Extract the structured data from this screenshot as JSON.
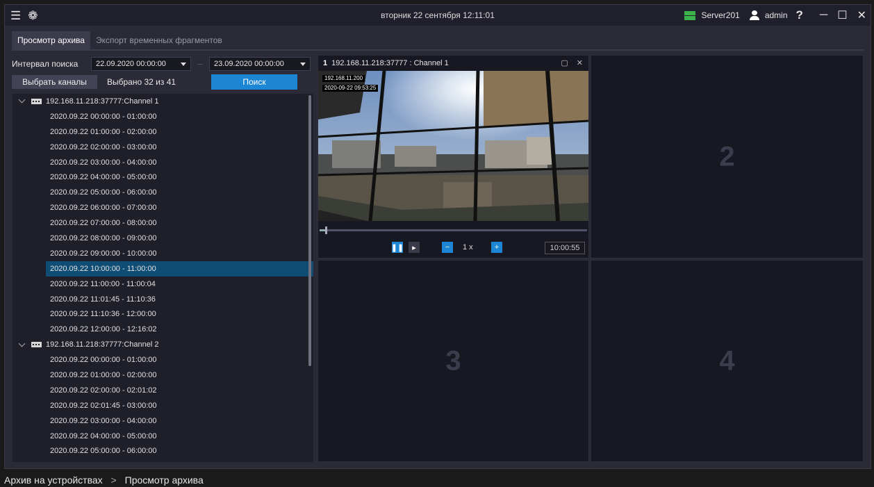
{
  "titlebar": {
    "datetime": "вторник 22 сентября 12:11:01",
    "server": "Server201",
    "user": "admin",
    "help_glyph": "?",
    "icons": [
      "menu-icon",
      "gear-icon",
      "server-icon",
      "user-icon",
      "minimize-icon",
      "maximize-icon",
      "close-icon"
    ]
  },
  "tabs": [
    "Просмотр архива",
    "Экспорт временных фрагментов"
  ],
  "search": {
    "interval_label": "Интервал поиска",
    "from": "22.09.2020 00:00:00",
    "to": "23.09.2020 00:00:00",
    "select_channels": "Выбрать каналы",
    "selected_count": "Выбрано 32 из 41",
    "search_button": "Поиск"
  },
  "tree": {
    "channels": [
      {
        "name": "192.168.11.218:37777:Channel 1",
        "records": [
          "2020.09.22 00:00:00 - 01:00:00",
          "2020.09.22 01:00:00 - 02:00:00",
          "2020.09.22 02:00:00 - 03:00:00",
          "2020.09.22 03:00:00 - 04:00:00",
          "2020.09.22 04:00:00 - 05:00:00",
          "2020.09.22 05:00:00 - 06:00:00",
          "2020.09.22 06:00:00 - 07:00:00",
          "2020.09.22 07:00:00 - 08:00:00",
          "2020.09.22 08:00:00 - 09:00:00",
          "2020.09.22 09:00:00 - 10:00:00",
          "2020.09.22 10:00:00 - 11:00:00",
          "2020.09.22 11:00:00 - 11:00:04",
          "2020.09.22 11:01:45 - 11:10:36",
          "2020.09.22 11:10:36 - 12:00:00",
          "2020.09.22 12:00:00 - 12:16:02"
        ]
      },
      {
        "name": "192.168.11.218:37777:Channel 2",
        "records": [
          "2020.09.22 00:00:00 - 01:00:00",
          "2020.09.22 01:00:00 - 02:00:00",
          "2020.09.22 02:00:00 - 02:01:02",
          "2020.09.22 02:01:45 - 03:00:00",
          "2020.09.22 03:00:00 - 04:00:00",
          "2020.09.22 04:00:00 - 05:00:00",
          "2020.09.22 05:00:00 - 06:00:00"
        ]
      }
    ],
    "selected": "2020.09.22 10:00:00 - 11:00:00"
  },
  "player": {
    "number": "1",
    "title": "192.168.11.218:37777 : Channel 1",
    "osd_ip": "192.168.11.200",
    "osd_time": "2020-09-22 09:53:25",
    "speed": "1 x",
    "time": "10:00:55",
    "progress": 0.02
  },
  "cells": [
    "2",
    "3",
    "4"
  ],
  "breadcrumb": {
    "root": "Архив на устройствах",
    "sep": ">",
    "current": "Просмотр архива"
  },
  "colors": {
    "accent": "#1d86d4",
    "selected_row": "#0f4d74",
    "server_green": "#3cb34a"
  }
}
